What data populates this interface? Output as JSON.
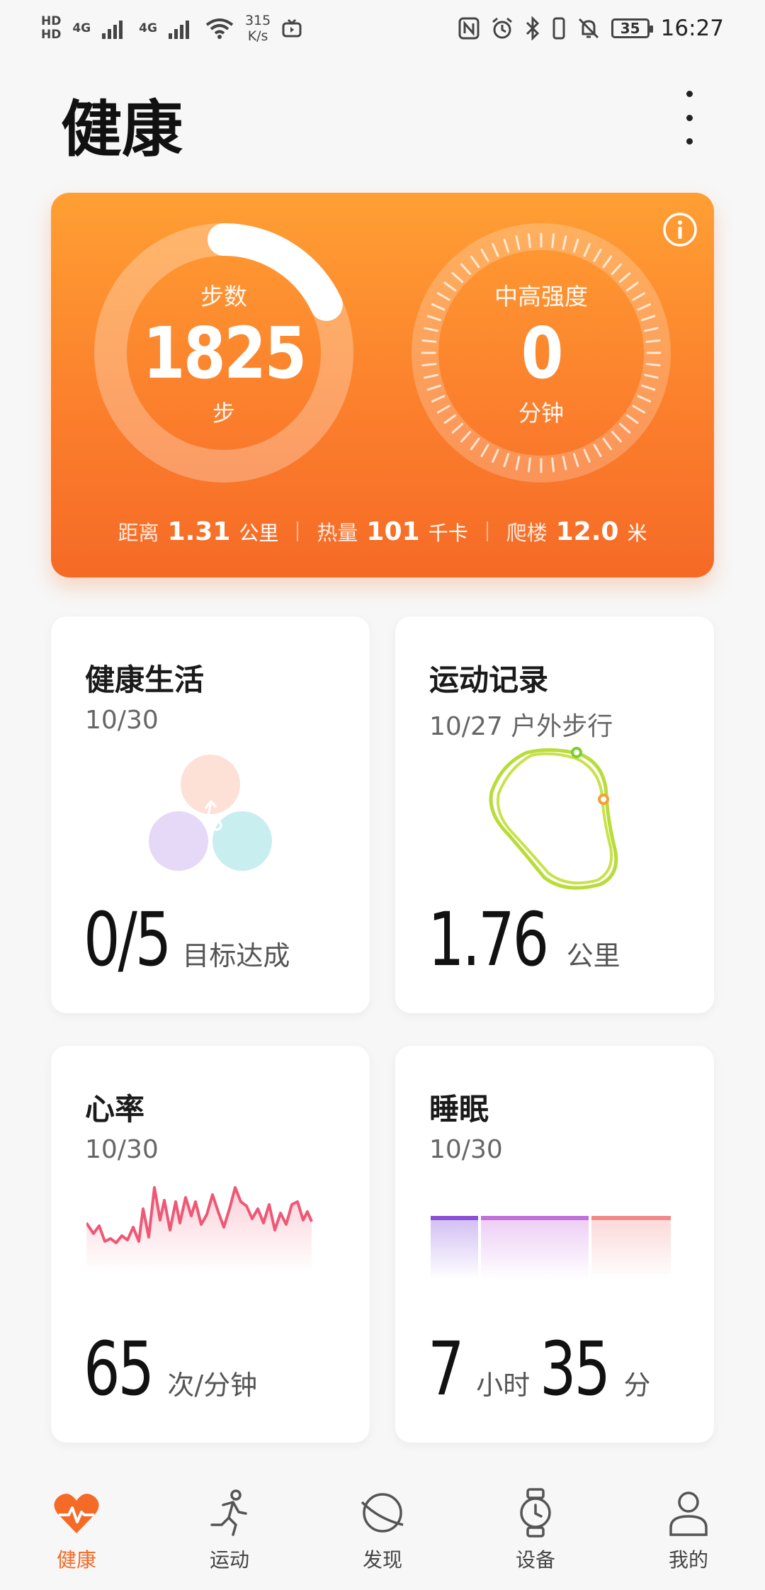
{
  "status_bar": {
    "hd1": "HD",
    "hd2": "HD",
    "net1": "4G",
    "net2": "4G",
    "speed_value": "315",
    "speed_unit": "K/s",
    "battery": "35",
    "time": "16:27"
  },
  "header": {
    "title": "健康"
  },
  "activity": {
    "steps_label": "步数",
    "steps_value": "1825",
    "steps_unit": "步",
    "steps_progress": 0.18,
    "intensity_label": "中高强度",
    "intensity_value": "0",
    "intensity_unit": "分钟",
    "stats": [
      {
        "label": "距离",
        "value": "1.31",
        "unit": "公里"
      },
      {
        "label": "热量",
        "value": "101",
        "unit": "千卡"
      },
      {
        "label": "爬楼",
        "value": "12.0",
        "unit": "米"
      }
    ],
    "colors": {
      "card_top": "#ff9f33",
      "card_bottom": "#f56a26"
    }
  },
  "tiles": {
    "healthy_life": {
      "title": "健康生活",
      "date": "10/30",
      "value": "0/5",
      "unit": "目标达成"
    },
    "workout": {
      "title": "运动记录",
      "date": "10/27 户外步行",
      "value": "1.76",
      "unit": "公里",
      "route_color": "#b8dc3a"
    },
    "heart_rate": {
      "title": "心率",
      "date": "10/30",
      "value": "65",
      "unit": "次/分钟",
      "line_color": "#ef5774"
    },
    "sleep": {
      "title": "睡眠",
      "date": "10/30",
      "hours": "7",
      "hours_unit": "小时",
      "minutes": "35",
      "minutes_unit": "分"
    }
  },
  "nav": {
    "items": [
      {
        "label": "健康",
        "icon": "heart-icon",
        "active": true
      },
      {
        "label": "运动",
        "icon": "runner-icon"
      },
      {
        "label": "发现",
        "icon": "planet-icon"
      },
      {
        "label": "设备",
        "icon": "watch-icon"
      },
      {
        "label": "我的",
        "icon": "person-icon"
      }
    ],
    "active_color": "#f46a26"
  }
}
